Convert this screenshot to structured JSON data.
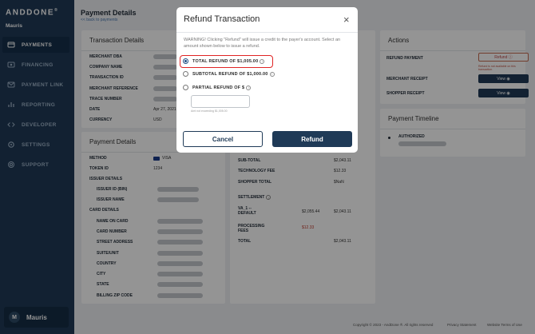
{
  "brand": {
    "logo": "ANDDONE",
    "merchant": "Mauris"
  },
  "nav": [
    {
      "label": "PAYMENTS",
      "icon": "payments-icon",
      "active": true
    },
    {
      "label": "FINANCING",
      "icon": "financing-icon",
      "active": false
    },
    {
      "label": "PAYMENT LINK",
      "icon": "payment-link-icon",
      "active": false
    },
    {
      "label": "REPORTING",
      "icon": "reporting-icon",
      "active": false
    },
    {
      "label": "DEVELOPER",
      "icon": "developer-icon",
      "active": false
    },
    {
      "label": "SETTINGS",
      "icon": "settings-icon",
      "active": false
    },
    {
      "label": "SUPPORT",
      "icon": "support-icon",
      "active": false
    }
  ],
  "user": {
    "initial": "M",
    "name": "Mauris"
  },
  "header": {
    "title": "Payment Details",
    "back": "<< back to payments"
  },
  "transaction_details": {
    "title": "Transaction Details",
    "rows": [
      {
        "label": "MERCHANT DBA",
        "value": ""
      },
      {
        "label": "COMPANY NAME",
        "value": ""
      },
      {
        "label": "TRANSACTION ID",
        "value": ""
      },
      {
        "label": "MERCHANT REFERENCE",
        "value": ""
      },
      {
        "label": "TRACE NUMBER",
        "value": ""
      },
      {
        "label": "DATE",
        "value": "Apr 27, 2021,"
      },
      {
        "label": "CURRENCY",
        "value": "USD"
      }
    ]
  },
  "payment_details": {
    "title": "Payment Details",
    "method_label": "METHOD",
    "method_value": "VISA",
    "token_label": "TOKEN ID",
    "token_value": "1234",
    "issuer_header": "ISSUER DETAILS",
    "issuer_rows": [
      "ISSUER ID (BIN)",
      "ISSUER NAME"
    ],
    "card_header": "CARD DETAILS",
    "card_rows": [
      "NAME ON CARD",
      "CARD NUMBER",
      "STREET ADDRESS",
      "SUITE/UNIT",
      "COUNTRY",
      "CITY",
      "STATE",
      "BILLING ZIP CODE"
    ]
  },
  "amounts": {
    "rows": [
      {
        "label": "SUB-TOTAL",
        "value": "$2,043.11"
      },
      {
        "label": "TECHNOLOGY FEE",
        "value": "$12.33"
      },
      {
        "label": "SHOPPER TOTAL",
        "value": "$NaN"
      }
    ],
    "settlement_label": "SETTLEMENT",
    "settlement_rows": [
      {
        "label": "VA_1 -- DEFAULT",
        "a": "$2,055.44",
        "b": "$2,043.11"
      },
      {
        "label": "PROCESSING FEES",
        "a": "$12.33",
        "b": ""
      },
      {
        "label": "TOTAL",
        "a": "",
        "b": "$2,043.11"
      }
    ]
  },
  "actions": {
    "title": "Actions",
    "refund_label": "REFUND PAYMENT",
    "refund_btn": "Refund",
    "refund_note": "Refund is not available on this transaction.",
    "merchant_receipt_label": "MERCHANT RECEIPT",
    "shopper_receipt_label": "SHOPPER RECEIPT",
    "view_btn": "View"
  },
  "timeline": {
    "title": "Payment Timeline",
    "status": "AUTHORIZED"
  },
  "modal": {
    "title": "Refund Transaction",
    "close": "×",
    "warning": "WARNING! Clicking \"Refund\" will issue a credit to the payer's account. Select an amount shown below to issue a refund.",
    "options": [
      {
        "label": "TOTAL REFUND OF $1,005.00",
        "checked": true
      },
      {
        "label": "SUBTOTAL REFUND OF $1,000.00",
        "checked": false
      },
      {
        "label": "PARTIAL REFUND OF $",
        "checked": false
      }
    ],
    "amount_value": "",
    "amount_hint": "Amt not exceeding $1,005.00",
    "cancel": "Cancel",
    "submit": "Refund"
  },
  "footer": {
    "copyright": "Copyright © 2023 - AndDone ®. All rights reserved",
    "privacy": "Privacy Statement",
    "terms": "Website Terms of Use"
  }
}
